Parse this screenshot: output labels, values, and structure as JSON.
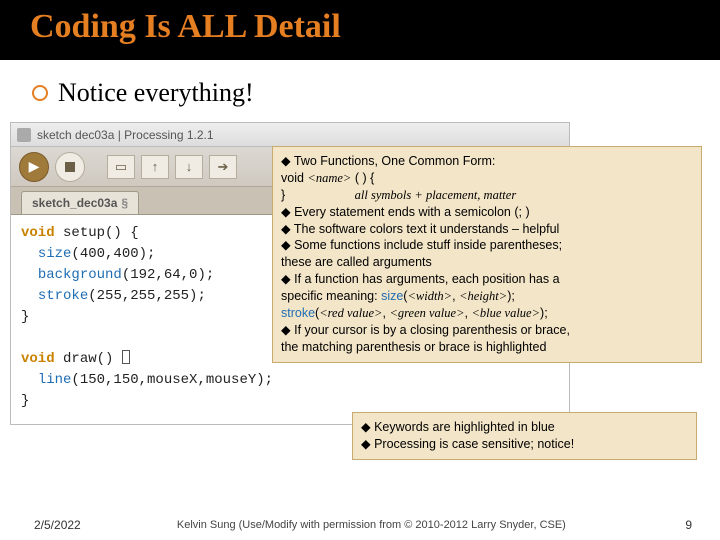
{
  "title": "Coding Is ALL Detail",
  "main_bullet": "Notice everything!",
  "ide": {
    "window_title": "sketch dec03a | Processing 1.2.1",
    "tab_name": "sketch_dec03a",
    "section_mark": "§",
    "code": {
      "line1a": "void",
      "line1b": " setup() {",
      "line2a": "  ",
      "line2b": "size",
      "line2c": "(400,400);",
      "line3a": "  ",
      "line3b": "background",
      "line3c": "(192,64,0);",
      "line4a": "  ",
      "line4b": "stroke",
      "line4c": "(255,255,255);",
      "line5": "}",
      "line6": "",
      "line7a": "void",
      "line7b": " draw() ",
      "line8a": "  ",
      "line8b": "line",
      "line8c": "(150,150,mouseX,mouseY);",
      "line9": "}"
    }
  },
  "callout_main": {
    "l1": "Two Functions, One Common Form:",
    "l2a": "void ",
    "l2b": "<name>",
    "l2c": " ( ) {",
    "l3a": "}",
    "l3b": "all symbols + placement, matter",
    "l4": "Every statement ends with a semicolon (; )",
    "l5": "The software colors text it understands – helpful",
    "l6a": "Some functions include stuff inside parentheses;",
    "l6b": "these are called arguments",
    "l7a": "If a function has arguments, each position has a",
    "l7b": "specific meaning: ",
    "l7c": "size",
    "l7d": "(",
    "l7e": "<width>",
    "l7f": ", ",
    "l7g": "<height>",
    "l7h": ");",
    "l8a": "stroke",
    "l8b": "(",
    "l8c": "<red value>",
    "l8d": ", ",
    "l8e": "<green value>",
    "l8f": ", ",
    "l8g": "<blue value>",
    "l8h": ");",
    "l9a": "If your cursor is by a closing parenthesis or brace,",
    "l9b": "the matching parenthesis or brace is highlighted"
  },
  "callout_small": {
    "l1": "Keywords are highlighted in blue",
    "l2": "Processing is case sensitive; notice!"
  },
  "footer": {
    "date": "2/5/2022",
    "credit": "Kelvin Sung (Use/Modify with permission from © 2010-2012 Larry Snyder, CSE)",
    "page": "9"
  }
}
